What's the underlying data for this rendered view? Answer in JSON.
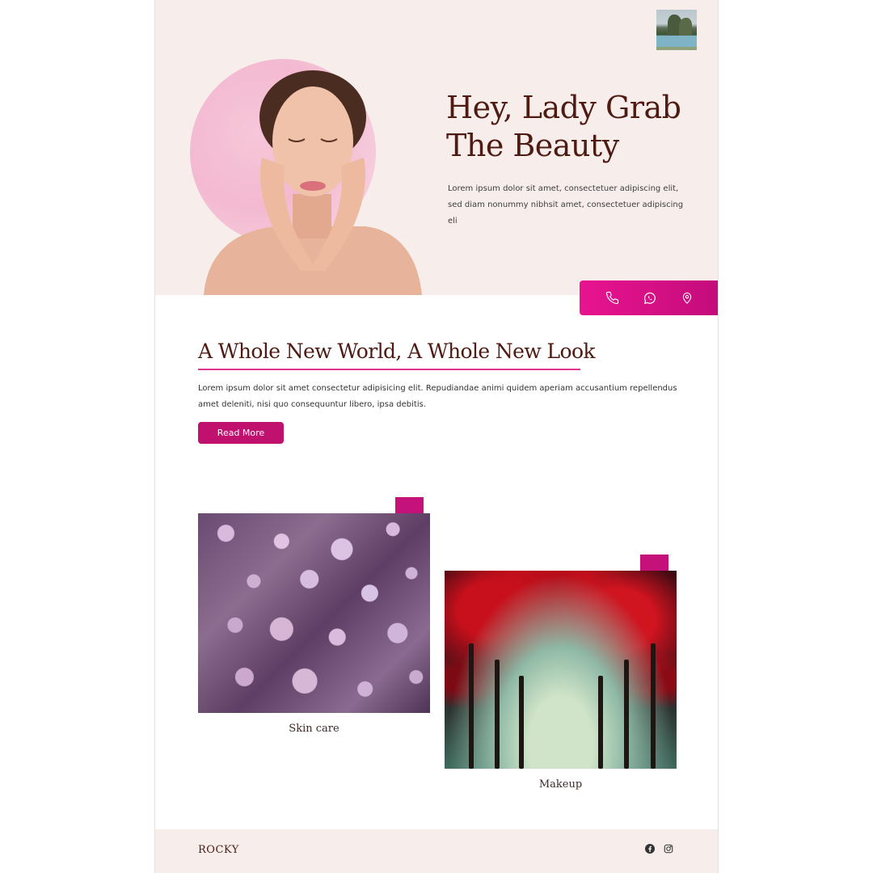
{
  "hero": {
    "title": "Hey, Lady Grab The Beauty",
    "text": "Lorem ipsum dolor sit amet, consectetuer adipiscing elit, sed diam nonummy nibhsit amet, consectetuer adipiscing eli"
  },
  "contact": {
    "icons": [
      "phone-icon",
      "whatsapp-icon",
      "location-pin-icon"
    ]
  },
  "section": {
    "title": "A Whole New World, A Whole New Look",
    "text": "Lorem ipsum dolor sit amet consectetur adipisicing elit. Repudiandae animi quidem aperiam accusantium repellendus amet deleniti, nisi quo consequuntur libero, ipsa debitis.",
    "button_label": "Read More"
  },
  "cards": [
    {
      "label": "Skin care"
    },
    {
      "label": "Makeup"
    }
  ],
  "footer": {
    "brand": "ROCKY",
    "icons": [
      "facebook-icon",
      "instagram-icon"
    ]
  },
  "colors": {
    "accent": "#c5127a",
    "brand_text": "#4e1a12",
    "hero_bg": "#f7eeec"
  }
}
